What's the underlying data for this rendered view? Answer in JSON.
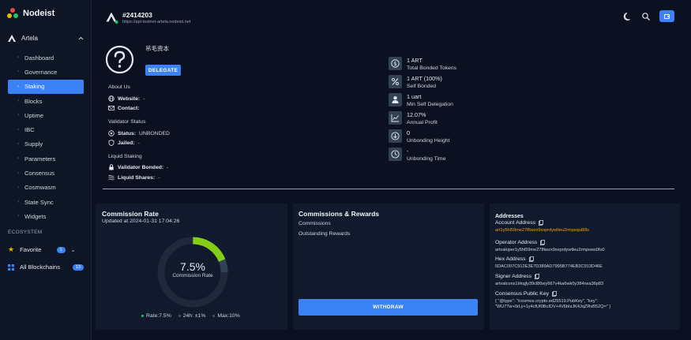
{
  "brand": {
    "title": "Nodeist"
  },
  "sidebar": {
    "chain": "Artela",
    "items": [
      {
        "label": "Dashboard",
        "active": false
      },
      {
        "label": "Governance",
        "active": false
      },
      {
        "label": "Staking",
        "active": true
      },
      {
        "label": "Blocks",
        "active": false
      },
      {
        "label": "Uptime",
        "active": false
      },
      {
        "label": "IBC",
        "active": false
      },
      {
        "label": "Supply",
        "active": false
      },
      {
        "label": "Parameters",
        "active": false
      },
      {
        "label": "Consensus",
        "active": false
      },
      {
        "label": "Cosmwasm",
        "active": false
      },
      {
        "label": "State Sync",
        "active": false
      },
      {
        "label": "Widgets",
        "active": false
      }
    ],
    "ecosystem_label": "ECOSYSTEM",
    "favorite": {
      "label": "Favorite",
      "count": "1"
    },
    "all_blockchains": {
      "label": "All Blockchains",
      "count": "13"
    }
  },
  "header": {
    "title": "#2414203",
    "url": "https://api-testnet-artela.nodeist.net"
  },
  "validator": {
    "moniker": "吊毛资本",
    "delegate_label": "DELEGATE",
    "about_label": "About Us",
    "website_label": "Website:",
    "website_value": "-",
    "contact_label": "Contact:",
    "contact_value": "",
    "status_section": "Validator Status",
    "status_label": "Status:",
    "status_value": "UNBONDED",
    "jailed_label": "Jailed:",
    "jailed_value": "-",
    "liquid_section": "Liquid Staking",
    "bonded_label": "Validator Bonded:",
    "bonded_value": "-",
    "shares_label": "Liquid Shares:",
    "shares_value": "-"
  },
  "stats": [
    {
      "icon": "dollar-icon",
      "value": "1 ART",
      "label": "Total Bonded Tokens"
    },
    {
      "icon": "percent-icon",
      "value": "1 ART (100%)",
      "label": "Self Bonded"
    },
    {
      "icon": "user-icon",
      "value": "1 uart",
      "label": "Min Self Delegation"
    },
    {
      "icon": "chart-icon",
      "value": "12.07%",
      "label": "Annual Profit"
    },
    {
      "icon": "arrow-down-circle-icon",
      "value": "0",
      "label": "Unbonding Height"
    },
    {
      "icon": "clock-icon",
      "value": "-",
      "label": "Unbonding Time"
    }
  ],
  "commission": {
    "title": "Commission Rate",
    "updated": "Updated at 2024-01-31 17:04:26",
    "rate_text": "7.5%",
    "rate_label": "Commission Rate",
    "rate": 7.5,
    "max_rate": 10,
    "legend": {
      "rate": "Rate:7.5%",
      "change": "24h: ±1%",
      "max": "Max:10%"
    }
  },
  "rewards": {
    "title": "Commissions & Rewards",
    "commissions_label": "Commissions",
    "outstanding_label": "Outstanding Rewards",
    "withdraw_label": "WITHDRAW"
  },
  "addresses": {
    "title": "Addresses",
    "account_label": "Account Address",
    "account_value": "art1y5hl59me278twzx9sxprdywtleu2rmpsqu80ls",
    "operator_label": "Operator Address",
    "operator_value": "artvaloper1y5hl59me278twzx9sxprdywtleu2rmpsws0fu0",
    "hex_label": "Hex Address",
    "hex_value": "5DAC097C912E3E7D389AD7995B774EB3C913D46E",
    "signer_label": "Signer Address",
    "signer_value": "artvalcons1lrkqjly39cl86wy667v4ka6wk0y384rwa36p83",
    "pubkey_label": "Consensus Public Key",
    "pubkey_value": "{ \"@type\": \"/cosmos.crypto.ed25519.PubKey\", \"key\": \"WU7Tw+0rLy+1y4cfUf0BcIDV+4V6bIzJK4JqZRvB52Q=\" }"
  },
  "colors": {
    "accent": "#3b82f6",
    "gauge_green": "#84cc16",
    "address_orange": "#f59e0b"
  }
}
